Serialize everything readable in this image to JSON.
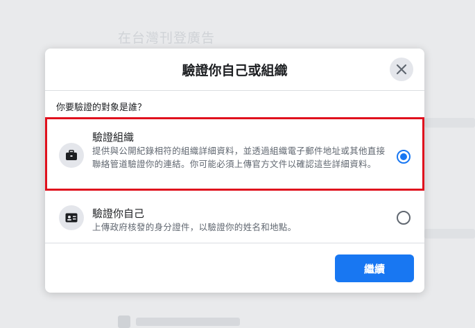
{
  "background": {
    "title": "在台灣刊登廣告"
  },
  "dialog": {
    "title": "驗證你自己或組織",
    "close_icon": "close-icon",
    "question": "你要驗證的對象是誰？",
    "options": [
      {
        "title": "驗證組織",
        "description": "提供與公開紀錄相符的組織詳細資料，並透過組織電子郵件地址或其他直接聯絡管道驗證你的連結。你可能必須上傳官方文件以確認這些詳細資料。",
        "icon": "briefcase-icon",
        "selected": true
      },
      {
        "title": "驗證你自己",
        "description": "上傳政府核發的身分證件，以驗證你的姓名和地點。",
        "icon": "id-card-icon",
        "selected": false
      }
    ],
    "continue_label": "繼續"
  },
  "colors": {
    "accent": "#1877f2",
    "highlight": "#e0101d"
  }
}
